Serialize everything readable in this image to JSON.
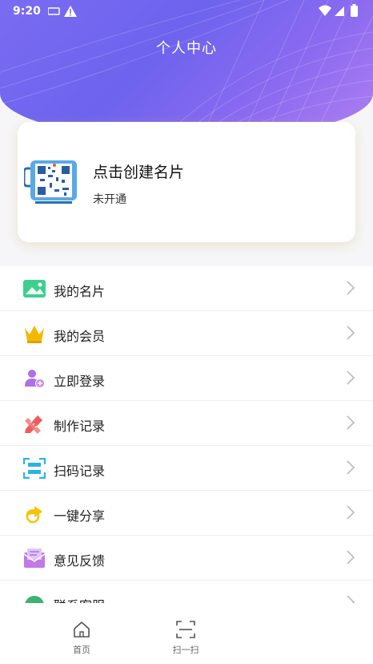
{
  "status_bar": {
    "time": "9:20"
  },
  "header": {
    "title": "个人中心"
  },
  "card": {
    "title": "点击创建名片",
    "status": "未开通"
  },
  "menu": {
    "items": [
      {
        "label": "我的名片",
        "icon": "image-card-icon"
      },
      {
        "label": "我的会员",
        "icon": "crown-icon"
      },
      {
        "label": "立即登录",
        "icon": "user-add-icon"
      },
      {
        "label": "制作记录",
        "icon": "pencil-ruler-icon"
      },
      {
        "label": "扫码记录",
        "icon": "scan-icon"
      },
      {
        "label": "一键分享",
        "icon": "share-icon"
      },
      {
        "label": "意见反馈",
        "icon": "mail-icon"
      },
      {
        "label": "联系客服",
        "icon": "service-icon"
      }
    ]
  },
  "tabbar": {
    "home": "首页",
    "scan": "扫一扫"
  },
  "colors": {
    "header": "#6d63ee",
    "green": "#3ecf8e",
    "gold": "#f5b800",
    "purple": "#b06ee8",
    "red": "#ef5b5b",
    "cyan": "#2bb3e8"
  }
}
